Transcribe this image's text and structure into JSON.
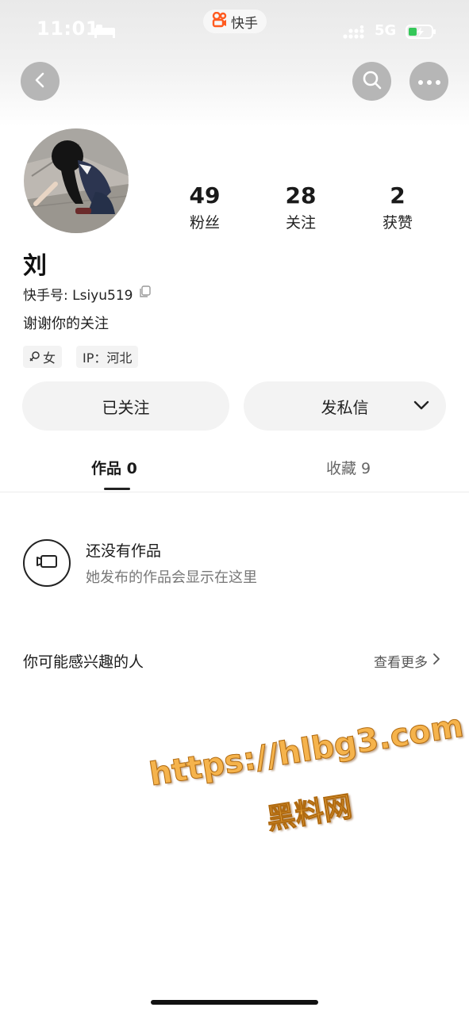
{
  "status_bar": {
    "time": "11:01",
    "app_name": "快手",
    "network": "5G",
    "icons": [
      "bed-icon",
      "signal-icon",
      "battery-charging-icon"
    ]
  },
  "nav": {
    "icons": [
      "back-icon",
      "search-icon",
      "more-icon"
    ]
  },
  "profile": {
    "stats": [
      {
        "value": "49",
        "label": "粉丝"
      },
      {
        "value": "28",
        "label": "关注"
      },
      {
        "value": "2",
        "label": "获赞"
      }
    ],
    "name": "刘",
    "id_label": "快手号: Lsiyu519",
    "bio": "谢谢你的关注",
    "tags": {
      "gender": "女",
      "ip": "IP：河北"
    },
    "following_button": "已关注",
    "message_button": "发私信"
  },
  "tabs": [
    {
      "label": "作品 0",
      "active": true
    },
    {
      "label": "收藏 9",
      "active": false
    }
  ],
  "empty_state": {
    "title": "还没有作品",
    "subtitle": "她发布的作品会显示在这里"
  },
  "recommend": {
    "title": "你可能感兴趣的人",
    "see_more": "查看更多"
  },
  "watermark": {
    "url": "https://hlbg3.com",
    "cn": "黑料网"
  },
  "colors": {
    "brand": "#ff5a1f",
    "button_bg": "#f3f3f3",
    "watermark": "#f5b34c"
  }
}
